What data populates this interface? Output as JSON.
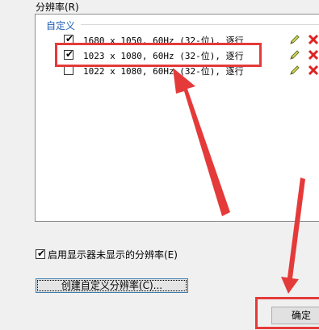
{
  "section": {
    "label": "分辨率(R)"
  },
  "group": {
    "label": "自定义"
  },
  "resolutions": [
    {
      "text": "1680 x 1050, 60Hz (32-位), 逐行",
      "checked": true
    },
    {
      "text": "1023 x 1080, 60Hz (32-位), 逐行",
      "checked": true
    },
    {
      "text": "1022 x 1080, 60Hz (32-位), 逐行",
      "checked": false
    }
  ],
  "options": {
    "show_unsupported_label": "启用显示器未显示的分辨率(E)",
    "show_unsupported_checked": true
  },
  "buttons": {
    "create_custom": "创建自定义分辨率(C)...",
    "ok": "确定"
  },
  "colors": {
    "highlight": "#e53a3a",
    "group_label": "#1f5fb5"
  }
}
